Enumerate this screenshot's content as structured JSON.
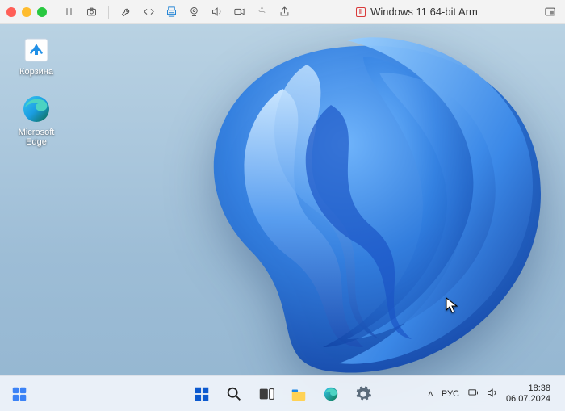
{
  "host": {
    "vm_title": "Windows 11 64-bit Arm"
  },
  "desktop": {
    "icons": [
      {
        "label": "Корзина"
      },
      {
        "label": "Microsoft Edge"
      }
    ]
  },
  "taskbar": {
    "tray": {
      "language": "РУС",
      "time": "18:38",
      "date": "06.07.2024"
    }
  }
}
